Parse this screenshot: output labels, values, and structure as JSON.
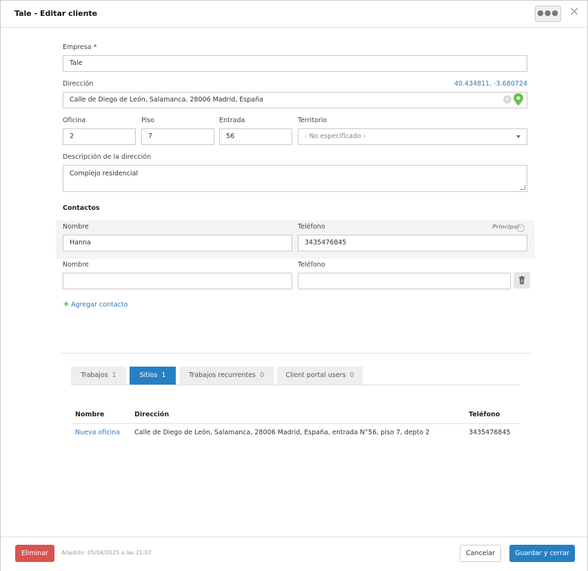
{
  "header": {
    "title": "Tale - Editar cliente",
    "menu_icon": "more-dots-icon",
    "close_icon": "close-icon"
  },
  "form": {
    "empresa_label": "Empresa",
    "required_mark": "*",
    "empresa_value": "Tale",
    "direccion_label": "Dirección",
    "coordinates": "40.434811, -3.680724",
    "direccion_value": "Calle de Diego de León, Salamanca, 28006 Madrid, España",
    "oficina_label": "Oficina",
    "oficina_value": "2",
    "piso_label": "Piso",
    "piso_value": "7",
    "entrada_label": "Entrada",
    "entrada_value": "56",
    "territorio_label": "Territorio",
    "territorio_value": "- No especificado -",
    "descripcion_label": "Descripción de la dirección",
    "descripcion_value": "Complejo residencial"
  },
  "contacts": {
    "title": "Contactos",
    "principal_label": "Principal",
    "add_label": "Agregar contacto",
    "items": [
      {
        "nombre_label": "Nombre",
        "nombre_value": "Hanna",
        "telefono_label": "Teléfono",
        "telefono_value": "3435476845"
      },
      {
        "nombre_label": "Nombre",
        "nombre_value": "",
        "telefono_label": "Teléfono",
        "telefono_value": ""
      }
    ]
  },
  "tabs": [
    {
      "label": "Trabajos",
      "count": "1"
    },
    {
      "label": "Sitios",
      "count": "1",
      "active": true
    },
    {
      "label": "Trabajos recurrentes",
      "count": "0"
    },
    {
      "label": "Client portal users",
      "count": "0"
    }
  ],
  "sites_table": {
    "headers": [
      "Nombre",
      "Dirección",
      "Teléfono"
    ],
    "rows": [
      [
        "Nueva oficina",
        "Calle de Diego de León, Salamanca, 28006 Madrid, España, entrada N°56, piso 7, depto 2",
        "3435476845"
      ]
    ]
  },
  "footer": {
    "delete_label": "Eliminar",
    "added_text": "Añadido: 05/04/2025 a las 21:07",
    "cancel_label": "Cancelar",
    "save_label": "Guardar y cerrar"
  },
  "colors": {
    "primary": "#2580c3",
    "danger": "#d9534f",
    "link": "#2b79bd",
    "pin": "#6cc04a"
  }
}
